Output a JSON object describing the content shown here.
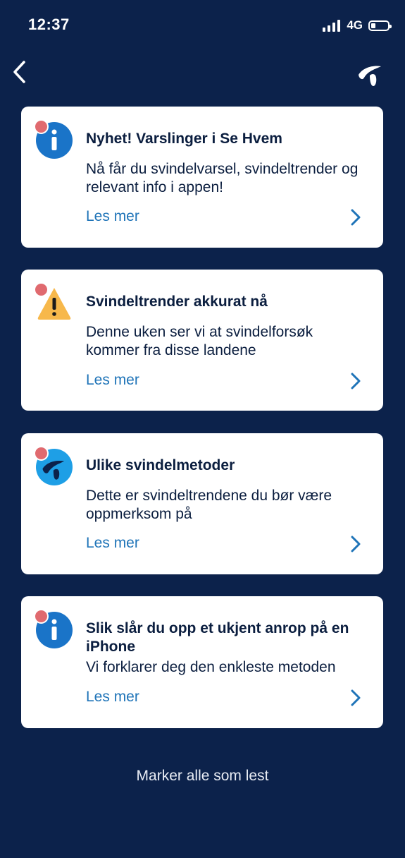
{
  "status": {
    "time": "12:37",
    "network": "4G"
  },
  "nav": {
    "back_icon": "chevron-left-icon",
    "logo_icon": "telenor-logo-icon"
  },
  "cards": [
    {
      "icon": "info-icon",
      "title": "Nyhet! Varslinger i Se Hvem",
      "body": "Nå får du svindelvarsel, svindeltrender og relevant info i appen!",
      "link": "Les mer"
    },
    {
      "icon": "warning-icon",
      "title": "Svindeltrender akkurat nå",
      "body": "Denne uken ser vi at svindelforsøk kommer fra disse landene",
      "link": "Les mer"
    },
    {
      "icon": "telenor-icon",
      "title": "Ulike svindelmetoder",
      "body": "Dette er svindeltrendene du bør være oppmerksom på",
      "link": "Les mer"
    },
    {
      "icon": "info-icon",
      "title": "Slik slår du opp et ukjent anrop på en iPhone",
      "body": "Vi forklarer deg den enkleste metoden",
      "link": "Les mer"
    }
  ],
  "footer": {
    "mark_all_label": "Marker alle som lest"
  },
  "colors": {
    "background": "#0c224b",
    "link": "#1f74b8",
    "unread": "#e06a6f",
    "info": "#1a74c8",
    "warning": "#f7b84b"
  }
}
